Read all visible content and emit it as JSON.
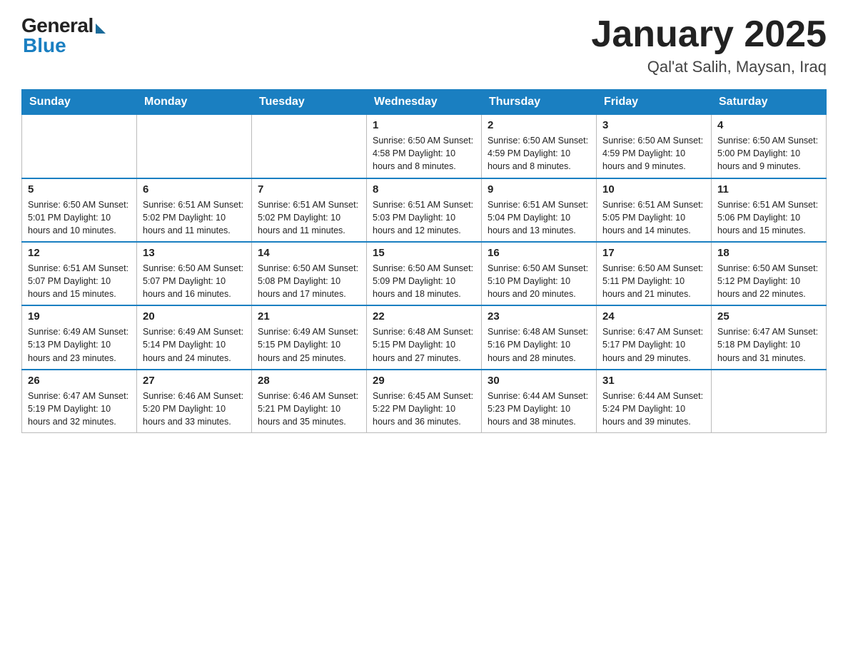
{
  "header": {
    "logo_general": "General",
    "logo_blue": "Blue",
    "title": "January 2025",
    "location": "Qal'at Salih, Maysan, Iraq"
  },
  "weekdays": [
    "Sunday",
    "Monday",
    "Tuesday",
    "Wednesday",
    "Thursday",
    "Friday",
    "Saturday"
  ],
  "weeks": [
    [
      {
        "day": "",
        "info": ""
      },
      {
        "day": "",
        "info": ""
      },
      {
        "day": "",
        "info": ""
      },
      {
        "day": "1",
        "info": "Sunrise: 6:50 AM\nSunset: 4:58 PM\nDaylight: 10 hours\nand 8 minutes."
      },
      {
        "day": "2",
        "info": "Sunrise: 6:50 AM\nSunset: 4:59 PM\nDaylight: 10 hours\nand 8 minutes."
      },
      {
        "day": "3",
        "info": "Sunrise: 6:50 AM\nSunset: 4:59 PM\nDaylight: 10 hours\nand 9 minutes."
      },
      {
        "day": "4",
        "info": "Sunrise: 6:50 AM\nSunset: 5:00 PM\nDaylight: 10 hours\nand 9 minutes."
      }
    ],
    [
      {
        "day": "5",
        "info": "Sunrise: 6:50 AM\nSunset: 5:01 PM\nDaylight: 10 hours\nand 10 minutes."
      },
      {
        "day": "6",
        "info": "Sunrise: 6:51 AM\nSunset: 5:02 PM\nDaylight: 10 hours\nand 11 minutes."
      },
      {
        "day": "7",
        "info": "Sunrise: 6:51 AM\nSunset: 5:02 PM\nDaylight: 10 hours\nand 11 minutes."
      },
      {
        "day": "8",
        "info": "Sunrise: 6:51 AM\nSunset: 5:03 PM\nDaylight: 10 hours\nand 12 minutes."
      },
      {
        "day": "9",
        "info": "Sunrise: 6:51 AM\nSunset: 5:04 PM\nDaylight: 10 hours\nand 13 minutes."
      },
      {
        "day": "10",
        "info": "Sunrise: 6:51 AM\nSunset: 5:05 PM\nDaylight: 10 hours\nand 14 minutes."
      },
      {
        "day": "11",
        "info": "Sunrise: 6:51 AM\nSunset: 5:06 PM\nDaylight: 10 hours\nand 15 minutes."
      }
    ],
    [
      {
        "day": "12",
        "info": "Sunrise: 6:51 AM\nSunset: 5:07 PM\nDaylight: 10 hours\nand 15 minutes."
      },
      {
        "day": "13",
        "info": "Sunrise: 6:50 AM\nSunset: 5:07 PM\nDaylight: 10 hours\nand 16 minutes."
      },
      {
        "day": "14",
        "info": "Sunrise: 6:50 AM\nSunset: 5:08 PM\nDaylight: 10 hours\nand 17 minutes."
      },
      {
        "day": "15",
        "info": "Sunrise: 6:50 AM\nSunset: 5:09 PM\nDaylight: 10 hours\nand 18 minutes."
      },
      {
        "day": "16",
        "info": "Sunrise: 6:50 AM\nSunset: 5:10 PM\nDaylight: 10 hours\nand 20 minutes."
      },
      {
        "day": "17",
        "info": "Sunrise: 6:50 AM\nSunset: 5:11 PM\nDaylight: 10 hours\nand 21 minutes."
      },
      {
        "day": "18",
        "info": "Sunrise: 6:50 AM\nSunset: 5:12 PM\nDaylight: 10 hours\nand 22 minutes."
      }
    ],
    [
      {
        "day": "19",
        "info": "Sunrise: 6:49 AM\nSunset: 5:13 PM\nDaylight: 10 hours\nand 23 minutes."
      },
      {
        "day": "20",
        "info": "Sunrise: 6:49 AM\nSunset: 5:14 PM\nDaylight: 10 hours\nand 24 minutes."
      },
      {
        "day": "21",
        "info": "Sunrise: 6:49 AM\nSunset: 5:15 PM\nDaylight: 10 hours\nand 25 minutes."
      },
      {
        "day": "22",
        "info": "Sunrise: 6:48 AM\nSunset: 5:15 PM\nDaylight: 10 hours\nand 27 minutes."
      },
      {
        "day": "23",
        "info": "Sunrise: 6:48 AM\nSunset: 5:16 PM\nDaylight: 10 hours\nand 28 minutes."
      },
      {
        "day": "24",
        "info": "Sunrise: 6:47 AM\nSunset: 5:17 PM\nDaylight: 10 hours\nand 29 minutes."
      },
      {
        "day": "25",
        "info": "Sunrise: 6:47 AM\nSunset: 5:18 PM\nDaylight: 10 hours\nand 31 minutes."
      }
    ],
    [
      {
        "day": "26",
        "info": "Sunrise: 6:47 AM\nSunset: 5:19 PM\nDaylight: 10 hours\nand 32 minutes."
      },
      {
        "day": "27",
        "info": "Sunrise: 6:46 AM\nSunset: 5:20 PM\nDaylight: 10 hours\nand 33 minutes."
      },
      {
        "day": "28",
        "info": "Sunrise: 6:46 AM\nSunset: 5:21 PM\nDaylight: 10 hours\nand 35 minutes."
      },
      {
        "day": "29",
        "info": "Sunrise: 6:45 AM\nSunset: 5:22 PM\nDaylight: 10 hours\nand 36 minutes."
      },
      {
        "day": "30",
        "info": "Sunrise: 6:44 AM\nSunset: 5:23 PM\nDaylight: 10 hours\nand 38 minutes."
      },
      {
        "day": "31",
        "info": "Sunrise: 6:44 AM\nSunset: 5:24 PM\nDaylight: 10 hours\nand 39 minutes."
      },
      {
        "day": "",
        "info": ""
      }
    ]
  ]
}
